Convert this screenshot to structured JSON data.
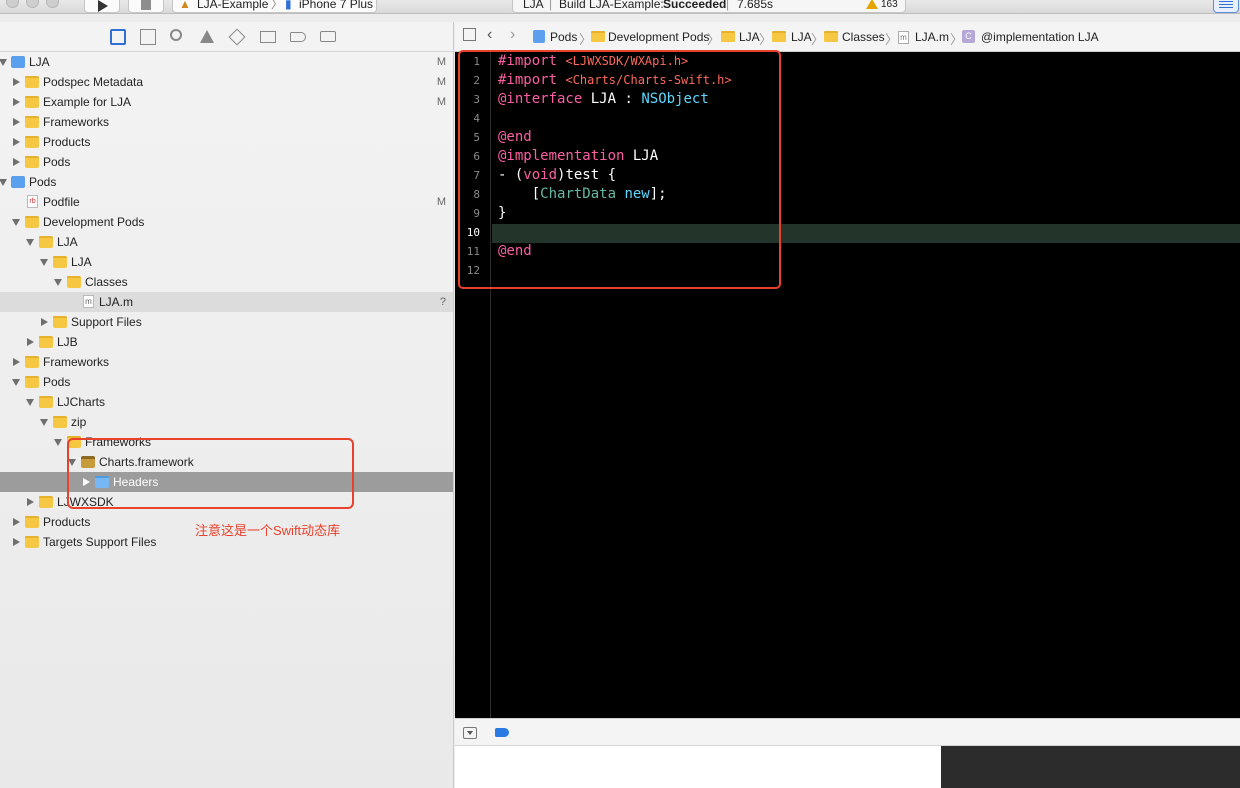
{
  "toolbar": {
    "scheme": "LJA-Example",
    "device": "iPhone 7 Plus",
    "activity_project": "LJA",
    "activity_build_prefix": "Build LJA-Example:",
    "activity_build_status": "Succeeded",
    "activity_time": "7.685s",
    "warning_count": "163"
  },
  "navigator": {
    "tree": [
      {
        "label": "LJA",
        "status": "M"
      },
      {
        "label": "Podspec Metadata",
        "status": "M"
      },
      {
        "label": "Example for LJA",
        "status": "M"
      },
      {
        "label": "Frameworks",
        "status": ""
      },
      {
        "label": "Products",
        "status": ""
      },
      {
        "label": "Pods",
        "status": ""
      },
      {
        "label": "Pods",
        "status": ""
      },
      {
        "label": "Podfile",
        "status": "M"
      },
      {
        "label": "Development Pods",
        "status": ""
      },
      {
        "label": "LJA",
        "status": ""
      },
      {
        "label": "LJA",
        "status": ""
      },
      {
        "label": "Classes",
        "status": ""
      },
      {
        "label": "LJA.m",
        "status": "?"
      },
      {
        "label": "Support Files",
        "status": ""
      },
      {
        "label": "LJB",
        "status": ""
      },
      {
        "label": "Frameworks",
        "status": ""
      },
      {
        "label": "Pods",
        "status": ""
      },
      {
        "label": "LJCharts",
        "status": ""
      },
      {
        "label": "zip",
        "status": ""
      },
      {
        "label": "Frameworks",
        "status": ""
      },
      {
        "label": "Charts.framework",
        "status": ""
      },
      {
        "label": "Headers",
        "status": ""
      },
      {
        "label": "LJWXSDK",
        "status": ""
      },
      {
        "label": "Products",
        "status": ""
      },
      {
        "label": "Targets Support Files",
        "status": ""
      }
    ],
    "annotation": "注意这是一个Swift动态库"
  },
  "jumpbar": {
    "crumbs": [
      "Pods",
      "Development Pods",
      "LJA",
      "LJA",
      "Classes",
      "LJA.m",
      "@implementation LJA"
    ]
  },
  "editor": {
    "current_line": 10,
    "line_numbers": [
      "1",
      "2",
      "3",
      "4",
      "5",
      "6",
      "7",
      "8",
      "9",
      "10",
      "11",
      "12"
    ],
    "code": {
      "l1_kw": "#import",
      "l1_inc": "<LJWXSDK/WXApi.h>",
      "l2_kw": "#import",
      "l2_inc": "<Charts/Charts-Swift.h>",
      "l3_kw": "@interface",
      "l3_name": "LJA",
      "l3_colon": ":",
      "l3_super": "NSObject",
      "l5_kw": "@end",
      "l6_kw": "@implementation",
      "l6_name": "LJA",
      "l7_pre": "- (",
      "l7_kw": "void",
      "l7_post": ")test {",
      "l8_pre": "    [",
      "l8_cls": "ChartData",
      "l8_sp": " ",
      "l8_mth": "new",
      "l8_post": "];",
      "l9": "}",
      "l11_kw": "@end"
    }
  },
  "colors": {
    "annotation_red": "#e8412c",
    "keyword_pink": "#fc5fa3",
    "type_cyan": "#5dd8ff"
  }
}
